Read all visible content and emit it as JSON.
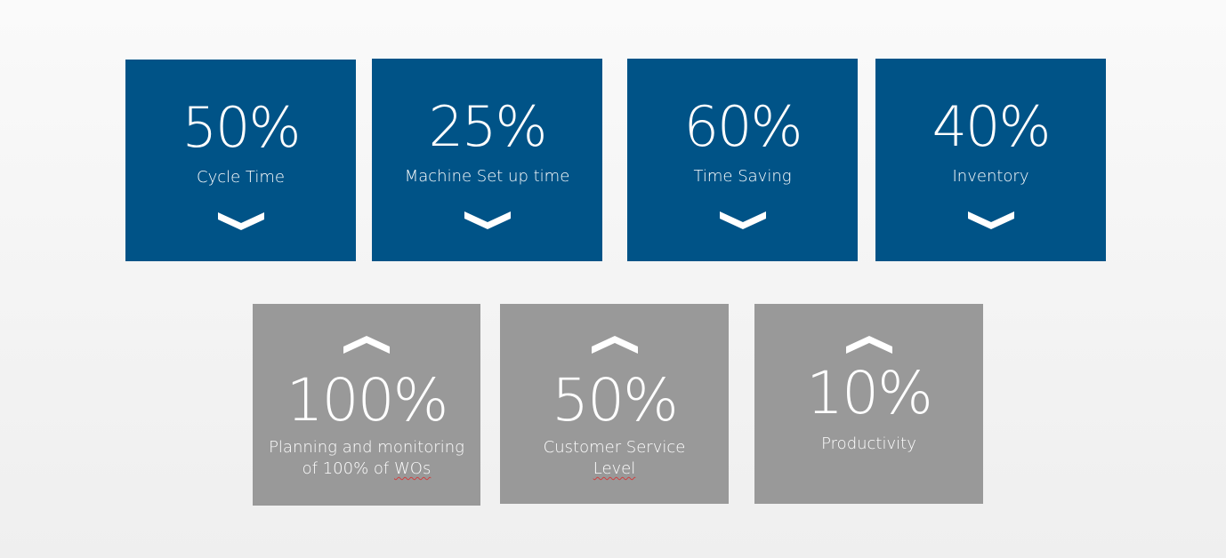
{
  "colors": {
    "blue_tile": "#005387",
    "gray_tile": "#999999",
    "text": "#ffffff"
  },
  "decrease_metrics": [
    {
      "value": "50%",
      "label": "Cycle Time",
      "icon": "chevron-down-icon"
    },
    {
      "value": "25%",
      "label": "Machine Set up time",
      "icon": "chevron-down-icon"
    },
    {
      "value": "60%",
      "label": "Time Saving",
      "icon": "chevron-down-icon"
    },
    {
      "value": "40%",
      "label": "Inventory",
      "icon": "chevron-down-icon"
    }
  ],
  "increase_metrics": [
    {
      "value": "100%",
      "label_line1": "Planning and monitoring",
      "label_line2_a": "of 100% of ",
      "label_line2_b": "WOs",
      "icon": "chevron-up-icon"
    },
    {
      "value": "50%",
      "label_line1": "Customer Service",
      "label_line2_a": "",
      "label_line2_b": "Level",
      "icon": "chevron-up-icon"
    },
    {
      "value": "10%",
      "label_line1": "Productivity",
      "label_line2_a": "",
      "label_line2_b": "",
      "icon": "chevron-up-icon"
    }
  ]
}
